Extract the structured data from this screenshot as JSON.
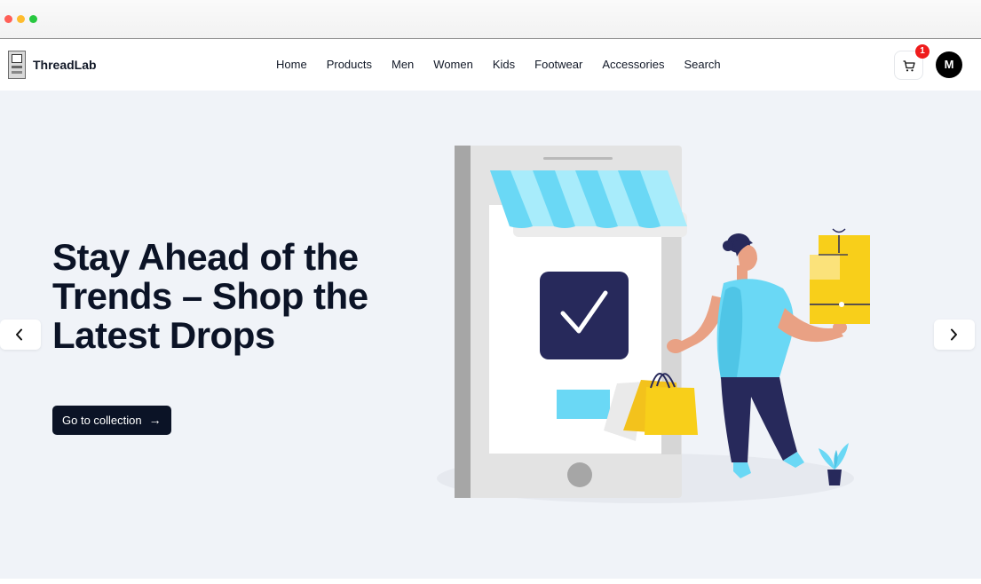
{
  "brand": {
    "name": "ThreadLab"
  },
  "nav": {
    "items": [
      "Home",
      "Products",
      "Men",
      "Women",
      "Kids",
      "Footwear",
      "Accessories",
      "Search"
    ]
  },
  "cart": {
    "count": "1",
    "icon": "cart-icon"
  },
  "user": {
    "initial": "M"
  },
  "hero": {
    "title": "Stay Ahead of the Trends – Shop the Latest Drops",
    "cta_label": "Go to collection",
    "cta_arrow": "→"
  },
  "slider": {
    "prev_icon": "chevron-left-icon",
    "next_icon": "chevron-right-icon"
  },
  "colors": {
    "accent_dark": "#0b1326",
    "badge_red": "#ef1c1c",
    "hero_bg": "#f0f3f8",
    "illustration_blue": "#6ad8f5",
    "illustration_yellow": "#f8cf1a",
    "illustration_navy": "#27295b"
  }
}
